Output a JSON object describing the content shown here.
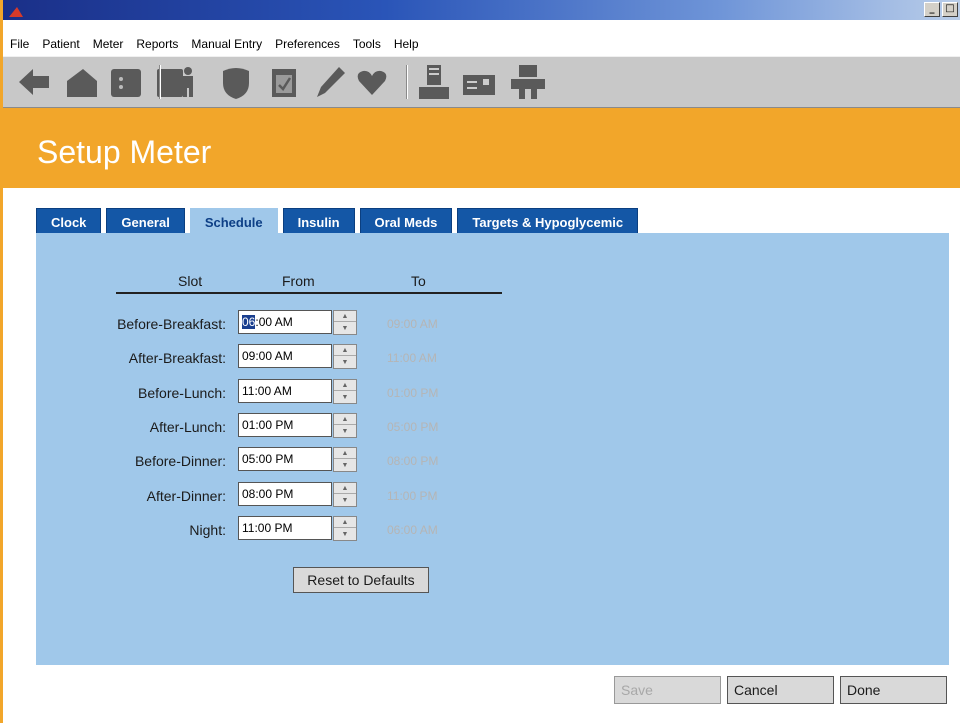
{
  "window": {
    "minimize_glyph": "_",
    "maximize_glyph": "□"
  },
  "menu": [
    "File",
    "Patient",
    "Meter",
    "Reports",
    "Manual Entry",
    "Preferences",
    "Tools",
    "Help"
  ],
  "toolbar_icons": [
    "back-arrow-icon",
    "home-icon",
    "meter-icon",
    "patient-figure-icon",
    "shield-icon",
    "clipboard-icon",
    "pencil-icon",
    "heart-icon",
    "document-printer-icon",
    "meter-card-icon",
    "device-transfer-icon"
  ],
  "page_title": "Setup Meter",
  "tabs": [
    {
      "label": "Clock"
    },
    {
      "label": "General"
    },
    {
      "label": "Schedule"
    },
    {
      "label": "Insulin"
    },
    {
      "label": "Oral Meds"
    },
    {
      "label": "Targets & Hypoglycemic"
    }
  ],
  "active_tab": "Schedule",
  "schedule": {
    "headers": {
      "slot": "Slot",
      "from": "From",
      "to": "To"
    },
    "rows": [
      {
        "label": "Before-Breakfast:",
        "from_sel": "06",
        "from_rest": ":00 AM",
        "to": "09:00 AM"
      },
      {
        "label": "After-Breakfast:",
        "from_sel": "",
        "from_rest": "09:00 AM",
        "to": "11:00 AM"
      },
      {
        "label": "Before-Lunch:",
        "from_sel": "",
        "from_rest": "11:00 AM",
        "to": "01:00 PM"
      },
      {
        "label": "After-Lunch:",
        "from_sel": "",
        "from_rest": "01:00 PM",
        "to": "05:00 PM"
      },
      {
        "label": "Before-Dinner:",
        "from_sel": "",
        "from_rest": "05:00 PM",
        "to": "08:00 PM"
      },
      {
        "label": "After-Dinner:",
        "from_sel": "",
        "from_rest": "08:00 PM",
        "to": "11:00 PM"
      },
      {
        "label": "Night:",
        "from_sel": "",
        "from_rest": "11:00 PM",
        "to": "06:00 AM"
      }
    ],
    "reset_label": "Reset to Defaults"
  },
  "buttons": {
    "save": "Save",
    "cancel": "Cancel",
    "done": "Done"
  },
  "colors": {
    "accent_orange": "#f2a62a",
    "tab_blue": "#1457a6",
    "panel_blue": "#a0c8ea"
  }
}
